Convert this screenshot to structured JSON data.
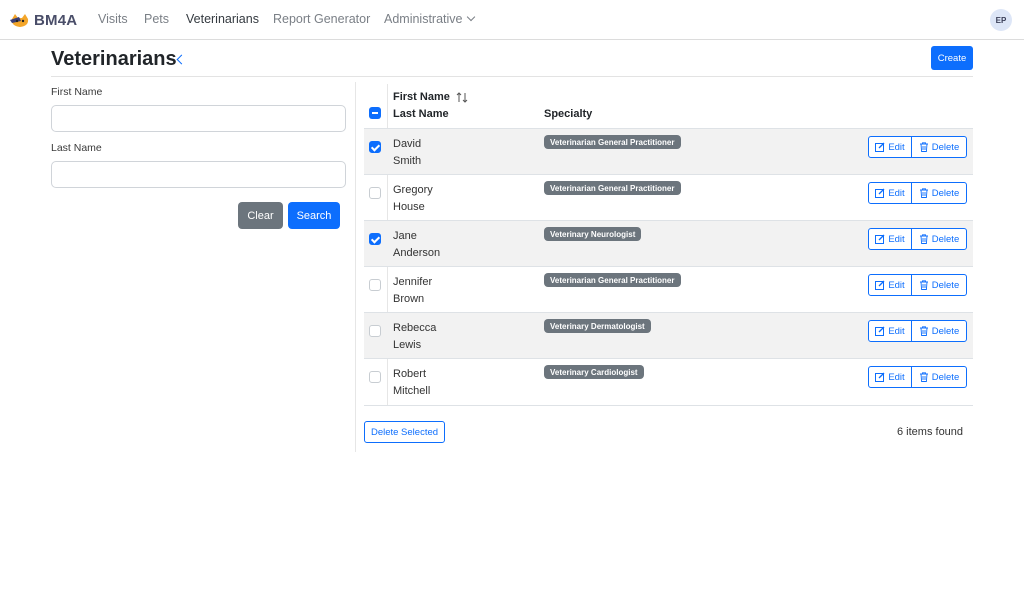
{
  "navbar": {
    "brand": "BM4A",
    "links": [
      "Visits",
      "Pets",
      "Veterinarians",
      "Report Generator",
      "Administrative"
    ],
    "user_initials": "EP"
  },
  "page": {
    "title": "Veterinarians",
    "create_label": "Create"
  },
  "filters": {
    "first_name_label": "First Name",
    "first_name_value": "",
    "last_name_label": "Last Name",
    "last_name_value": "",
    "clear_label": "Clear",
    "search_label": "Search"
  },
  "table": {
    "headers": {
      "first_name": "First Name",
      "last_name": "Last Name",
      "specialty": "Specialty"
    },
    "rows": [
      {
        "first_name": "David",
        "last_name": "Smith",
        "specialty": "Veterinarian General Practitioner",
        "checked": true
      },
      {
        "first_name": "Gregory",
        "last_name": "House",
        "specialty": "Veterinarian General Practitioner",
        "checked": false
      },
      {
        "first_name": "Jane",
        "last_name": "Anderson",
        "specialty": "Veterinary Neurologist",
        "checked": true
      },
      {
        "first_name": "Jennifer",
        "last_name": "Brown",
        "specialty": "Veterinarian General Practitioner",
        "checked": false
      },
      {
        "first_name": "Rebecca",
        "last_name": "Lewis",
        "specialty": "Veterinary Dermatologist",
        "checked": false
      },
      {
        "first_name": "Robert",
        "last_name": "Mitchell",
        "specialty": "Veterinary Cardiologist",
        "checked": false
      }
    ],
    "edit_label": "Edit",
    "delete_label": "Delete"
  },
  "footer": {
    "delete_selected_label": "Delete Selected",
    "items_found": "6 items found"
  },
  "colors": {
    "primary": "#0d6efd",
    "secondary": "#6c757d",
    "brand_text": "#4a4e69"
  }
}
